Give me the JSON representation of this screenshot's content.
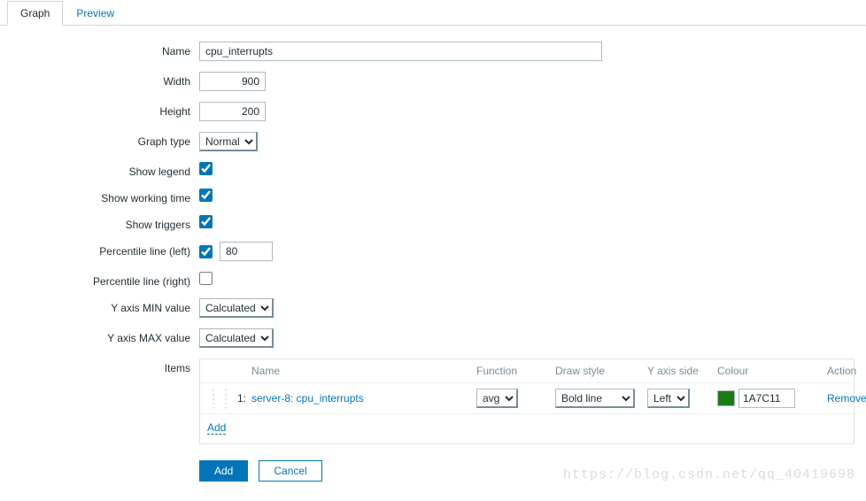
{
  "tabs": {
    "graph": "Graph",
    "preview": "Preview"
  },
  "labels": {
    "name": "Name",
    "width": "Width",
    "height": "Height",
    "graph_type": "Graph type",
    "show_legend": "Show legend",
    "show_working_time": "Show working time",
    "show_triggers": "Show triggers",
    "percentile_left": "Percentile line (left)",
    "percentile_right": "Percentile line (right)",
    "y_min": "Y axis MIN value",
    "y_max": "Y axis MAX value",
    "items": "Items"
  },
  "values": {
    "name": "cpu_interrupts",
    "width": "900",
    "height": "200",
    "graph_type": "Normal",
    "show_legend": true,
    "show_working_time": true,
    "show_triggers": true,
    "percentile_left_checked": true,
    "percentile_left_value": "80",
    "percentile_right_checked": false,
    "y_min": "Calculated",
    "y_max": "Calculated"
  },
  "items_head": {
    "name": "Name",
    "function": "Function",
    "draw_style": "Draw style",
    "y_axis_side": "Y axis side",
    "colour": "Colour",
    "action": "Action"
  },
  "items_rows": [
    {
      "index": "1:",
      "name": "server-8: cpu_interrupts",
      "function": "avg",
      "draw_style": "Bold line",
      "y_axis_side": "Left",
      "colour_hex": "1A7C11",
      "colour_css": "#1A7C11",
      "action": "Remove"
    }
  ],
  "links": {
    "add": "Add"
  },
  "buttons": {
    "add": "Add",
    "cancel": "Cancel"
  },
  "watermark": "https://blog.csdn.net/qq_40419698"
}
